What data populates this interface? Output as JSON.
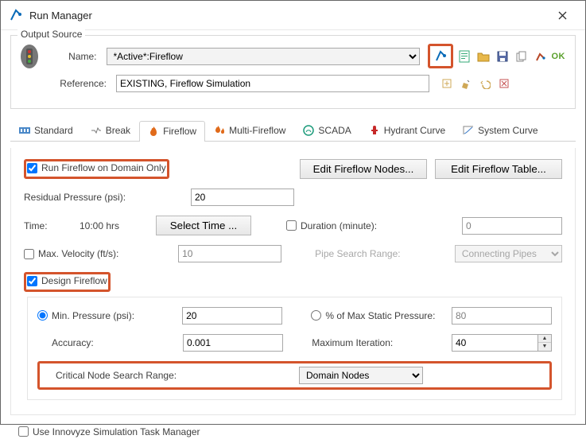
{
  "window": {
    "title": "Run Manager"
  },
  "outputSource": {
    "legend": "Output Source",
    "nameLabel": "Name:",
    "nameValue": "*Active*:Fireflow",
    "referenceLabel": "Reference:",
    "referenceValue": "EXISTING, Fireflow Simulation"
  },
  "tabs": {
    "standard": "Standard",
    "break": "Break",
    "fireflow": "Fireflow",
    "multiFireflow": "Multi-Fireflow",
    "scada": "SCADA",
    "hydrantCurve": "Hydrant Curve",
    "systemCurve": "System Curve"
  },
  "fireflow": {
    "runDomainOnly": "Run Fireflow on Domain Only",
    "editNodes": "Edit Fireflow Nodes...",
    "editTable": "Edit Fireflow Table...",
    "residualPressureLabel": "Residual Pressure (psi):",
    "residualPressureValue": "20",
    "timeLabel": "Time:",
    "timeValue": "10:00 hrs",
    "selectTime": "Select Time ...",
    "durationLabel": "Duration (minute):",
    "durationValue": "0",
    "maxVelocityLabel": "Max. Velocity (ft/s):",
    "maxVelocityValue": "10",
    "pipeSearchLabel": "Pipe Search Range:",
    "pipeSearchValue": "Connecting Pipes",
    "designFireflow": "Design Fireflow",
    "minPressureLabel": "Min. Pressure (psi):",
    "minPressureValue": "20",
    "pctMaxStaticLabel": "% of Max Static Pressure:",
    "pctMaxStaticValue": "80",
    "accuracyLabel": "Accuracy:",
    "accuracyValue": "0.001",
    "maxIterationLabel": "Maximum Iteration:",
    "maxIterationValue": "40",
    "criticalNodeLabel": "Critical Node Search Range:",
    "criticalNodeValue": "Domain Nodes"
  },
  "footer": {
    "useTaskManager": "Use Innovyze Simulation Task Manager"
  },
  "ok": "OK"
}
